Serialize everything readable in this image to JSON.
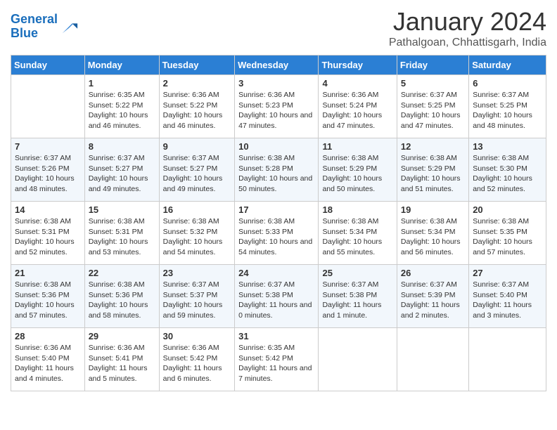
{
  "logo": {
    "line1": "General",
    "line2": "Blue"
  },
  "title": "January 2024",
  "subtitle": "Pathalgoan, Chhattisgarh, India",
  "days_header": [
    "Sunday",
    "Monday",
    "Tuesday",
    "Wednesday",
    "Thursday",
    "Friday",
    "Saturday"
  ],
  "weeks": [
    [
      {
        "day": "",
        "sunrise": "",
        "sunset": "",
        "daylight": ""
      },
      {
        "day": "1",
        "sunrise": "Sunrise: 6:35 AM",
        "sunset": "Sunset: 5:22 PM",
        "daylight": "Daylight: 10 hours and 46 minutes."
      },
      {
        "day": "2",
        "sunrise": "Sunrise: 6:36 AM",
        "sunset": "Sunset: 5:22 PM",
        "daylight": "Daylight: 10 hours and 46 minutes."
      },
      {
        "day": "3",
        "sunrise": "Sunrise: 6:36 AM",
        "sunset": "Sunset: 5:23 PM",
        "daylight": "Daylight: 10 hours and 47 minutes."
      },
      {
        "day": "4",
        "sunrise": "Sunrise: 6:36 AM",
        "sunset": "Sunset: 5:24 PM",
        "daylight": "Daylight: 10 hours and 47 minutes."
      },
      {
        "day": "5",
        "sunrise": "Sunrise: 6:37 AM",
        "sunset": "Sunset: 5:25 PM",
        "daylight": "Daylight: 10 hours and 47 minutes."
      },
      {
        "day": "6",
        "sunrise": "Sunrise: 6:37 AM",
        "sunset": "Sunset: 5:25 PM",
        "daylight": "Daylight: 10 hours and 48 minutes."
      }
    ],
    [
      {
        "day": "7",
        "sunrise": "Sunrise: 6:37 AM",
        "sunset": "Sunset: 5:26 PM",
        "daylight": "Daylight: 10 hours and 48 minutes."
      },
      {
        "day": "8",
        "sunrise": "Sunrise: 6:37 AM",
        "sunset": "Sunset: 5:27 PM",
        "daylight": "Daylight: 10 hours and 49 minutes."
      },
      {
        "day": "9",
        "sunrise": "Sunrise: 6:37 AM",
        "sunset": "Sunset: 5:27 PM",
        "daylight": "Daylight: 10 hours and 49 minutes."
      },
      {
        "day": "10",
        "sunrise": "Sunrise: 6:38 AM",
        "sunset": "Sunset: 5:28 PM",
        "daylight": "Daylight: 10 hours and 50 minutes."
      },
      {
        "day": "11",
        "sunrise": "Sunrise: 6:38 AM",
        "sunset": "Sunset: 5:29 PM",
        "daylight": "Daylight: 10 hours and 50 minutes."
      },
      {
        "day": "12",
        "sunrise": "Sunrise: 6:38 AM",
        "sunset": "Sunset: 5:29 PM",
        "daylight": "Daylight: 10 hours and 51 minutes."
      },
      {
        "day": "13",
        "sunrise": "Sunrise: 6:38 AM",
        "sunset": "Sunset: 5:30 PM",
        "daylight": "Daylight: 10 hours and 52 minutes."
      }
    ],
    [
      {
        "day": "14",
        "sunrise": "Sunrise: 6:38 AM",
        "sunset": "Sunset: 5:31 PM",
        "daylight": "Daylight: 10 hours and 52 minutes."
      },
      {
        "day": "15",
        "sunrise": "Sunrise: 6:38 AM",
        "sunset": "Sunset: 5:31 PM",
        "daylight": "Daylight: 10 hours and 53 minutes."
      },
      {
        "day": "16",
        "sunrise": "Sunrise: 6:38 AM",
        "sunset": "Sunset: 5:32 PM",
        "daylight": "Daylight: 10 hours and 54 minutes."
      },
      {
        "day": "17",
        "sunrise": "Sunrise: 6:38 AM",
        "sunset": "Sunset: 5:33 PM",
        "daylight": "Daylight: 10 hours and 54 minutes."
      },
      {
        "day": "18",
        "sunrise": "Sunrise: 6:38 AM",
        "sunset": "Sunset: 5:34 PM",
        "daylight": "Daylight: 10 hours and 55 minutes."
      },
      {
        "day": "19",
        "sunrise": "Sunrise: 6:38 AM",
        "sunset": "Sunset: 5:34 PM",
        "daylight": "Daylight: 10 hours and 56 minutes."
      },
      {
        "day": "20",
        "sunrise": "Sunrise: 6:38 AM",
        "sunset": "Sunset: 5:35 PM",
        "daylight": "Daylight: 10 hours and 57 minutes."
      }
    ],
    [
      {
        "day": "21",
        "sunrise": "Sunrise: 6:38 AM",
        "sunset": "Sunset: 5:36 PM",
        "daylight": "Daylight: 10 hours and 57 minutes."
      },
      {
        "day": "22",
        "sunrise": "Sunrise: 6:38 AM",
        "sunset": "Sunset: 5:36 PM",
        "daylight": "Daylight: 10 hours and 58 minutes."
      },
      {
        "day": "23",
        "sunrise": "Sunrise: 6:37 AM",
        "sunset": "Sunset: 5:37 PM",
        "daylight": "Daylight: 10 hours and 59 minutes."
      },
      {
        "day": "24",
        "sunrise": "Sunrise: 6:37 AM",
        "sunset": "Sunset: 5:38 PM",
        "daylight": "Daylight: 11 hours and 0 minutes."
      },
      {
        "day": "25",
        "sunrise": "Sunrise: 6:37 AM",
        "sunset": "Sunset: 5:38 PM",
        "daylight": "Daylight: 11 hours and 1 minute."
      },
      {
        "day": "26",
        "sunrise": "Sunrise: 6:37 AM",
        "sunset": "Sunset: 5:39 PM",
        "daylight": "Daylight: 11 hours and 2 minutes."
      },
      {
        "day": "27",
        "sunrise": "Sunrise: 6:37 AM",
        "sunset": "Sunset: 5:40 PM",
        "daylight": "Daylight: 11 hours and 3 minutes."
      }
    ],
    [
      {
        "day": "28",
        "sunrise": "Sunrise: 6:36 AM",
        "sunset": "Sunset: 5:40 PM",
        "daylight": "Daylight: 11 hours and 4 minutes."
      },
      {
        "day": "29",
        "sunrise": "Sunrise: 6:36 AM",
        "sunset": "Sunset: 5:41 PM",
        "daylight": "Daylight: 11 hours and 5 minutes."
      },
      {
        "day": "30",
        "sunrise": "Sunrise: 6:36 AM",
        "sunset": "Sunset: 5:42 PM",
        "daylight": "Daylight: 11 hours and 6 minutes."
      },
      {
        "day": "31",
        "sunrise": "Sunrise: 6:35 AM",
        "sunset": "Sunset: 5:42 PM",
        "daylight": "Daylight: 11 hours and 7 minutes."
      },
      {
        "day": "",
        "sunrise": "",
        "sunset": "",
        "daylight": ""
      },
      {
        "day": "",
        "sunrise": "",
        "sunset": "",
        "daylight": ""
      },
      {
        "day": "",
        "sunrise": "",
        "sunset": "",
        "daylight": ""
      }
    ]
  ]
}
